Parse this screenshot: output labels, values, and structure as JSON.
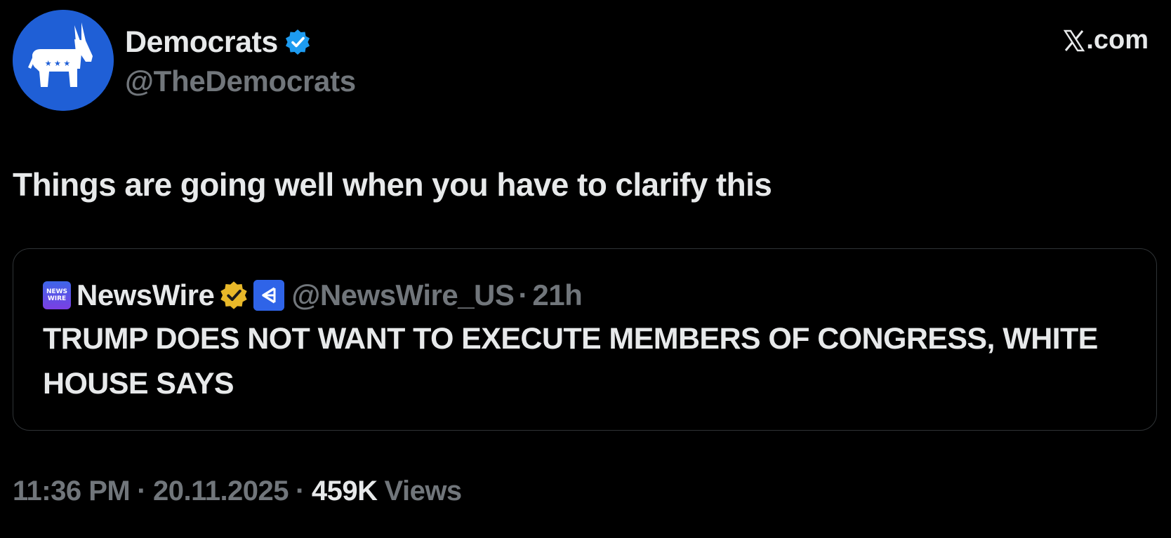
{
  "author": {
    "display_name": "Democrats",
    "handle": "@TheDemocrats",
    "avatar_icon": "donkey-logo-icon",
    "avatar_color": "#1f5fd6",
    "verified_icon": "verified-badge-icon",
    "verified_color": "#1d9bf0"
  },
  "site": {
    "label": ".com",
    "logo_icon": "x-logo-icon"
  },
  "tweet": {
    "text": "Things are going well when you have to clarify this"
  },
  "quote": {
    "logo_lines": [
      "NEWS",
      "WIRE"
    ],
    "display_name": "NewsWire",
    "handle": "@NewsWire_US",
    "separator": "·",
    "time": "21h",
    "gold_badge_icon": "gold-verified-badge-icon",
    "gold_badge_color": "#e8b829",
    "affiliate_icon": "affiliate-badge-icon",
    "text": "TRUMP DOES NOT WANT TO EXECUTE MEMBERS OF CONGRESS, WHITE HOUSE SAYS"
  },
  "meta": {
    "time": "11:36 PM",
    "date": "20.11.2025",
    "separator": "·",
    "views_count": "459K",
    "views_label": "Views"
  },
  "colors": {
    "background": "#000000",
    "primary_text": "#e7e9ea",
    "secondary_text": "#71767b",
    "border": "#2f3336"
  }
}
